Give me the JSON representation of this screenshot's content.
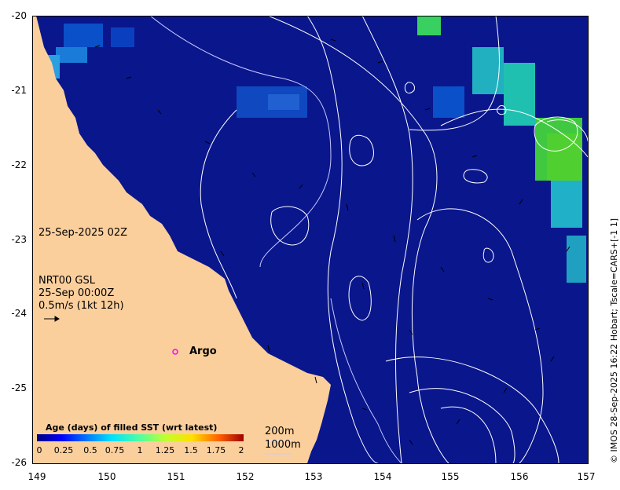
{
  "map": {
    "timestamp": "25-Sep-2025 02Z",
    "current_source": {
      "line1": "NRT00 GSL",
      "line2": "25-Sep 00:00Z",
      "line3": "0.5m/s (1kt 12h)"
    },
    "argo_label": "Argo",
    "credit": "© IMOS 28-Sep-2025 16:22 Hobart; Tscale=CARS+[-1 1]",
    "depth_labels": [
      "200m",
      "1000m"
    ],
    "y_ticks": [
      "-20",
      "-21",
      "-22",
      "-23",
      "-24",
      "-25",
      "-26"
    ],
    "x_ticks": [
      "149",
      "150",
      "151",
      "152",
      "153",
      "154",
      "155",
      "156",
      "157"
    ],
    "legend": {
      "title": "Age (days) of filled SST (wrt latest)",
      "ticks": [
        "0",
        "0.25",
        "0.5",
        "0.75",
        "1",
        "1.25",
        "1.5",
        "1.75",
        "2"
      ]
    },
    "colors": {
      "land": "#fbcf9c",
      "ocean": "#0a168c",
      "ocean_alt": "#0520a8",
      "contour": "#ffffff",
      "argo_marker": "#ff00ff"
    },
    "argo_position": {
      "lon": 151,
      "lat": -24.55
    }
  }
}
